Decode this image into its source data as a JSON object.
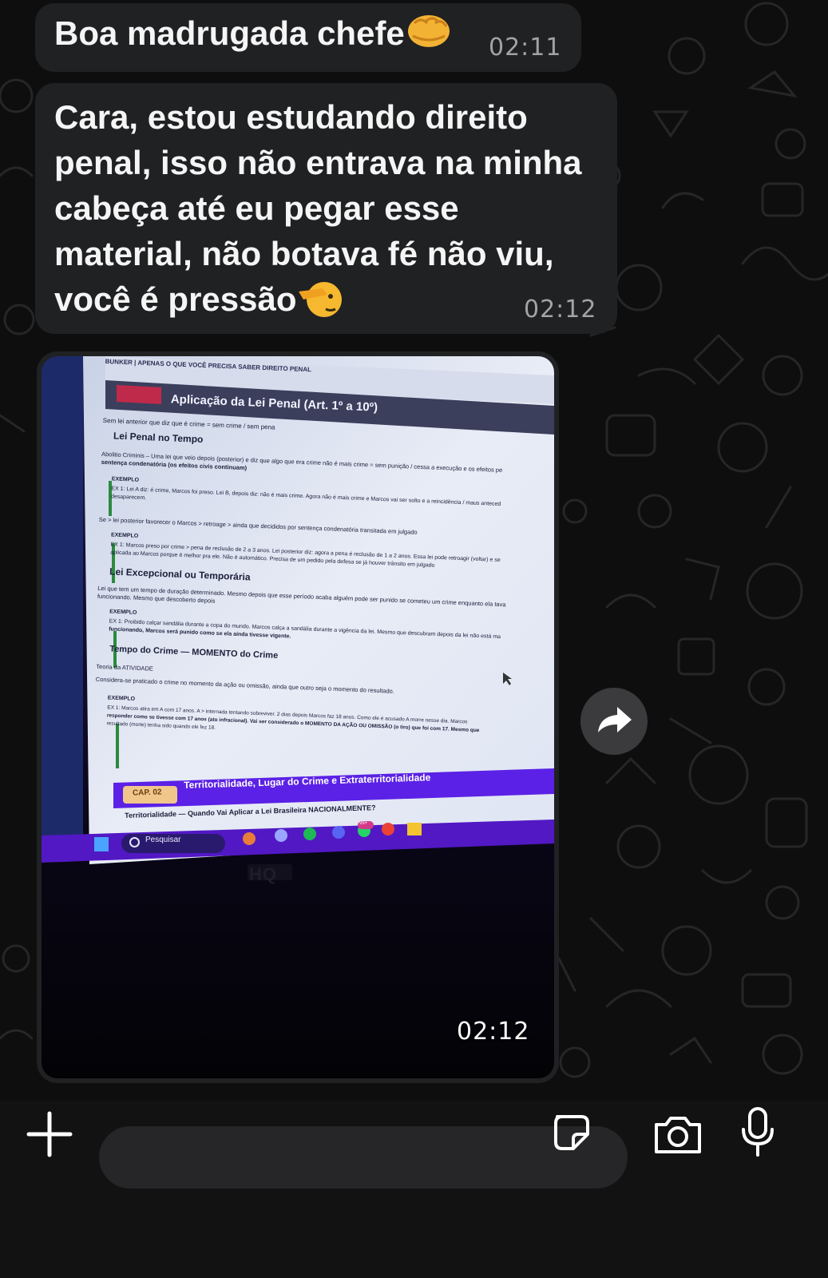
{
  "messages": [
    {
      "id": "m1",
      "text_line1": "Boa madrugada chefe",
      "emoji": "oncoming-fist",
      "time": "02:11"
    },
    {
      "id": "m2",
      "lines": [
        "Cara, estou estudando direito",
        "penal, isso não entrava na minha",
        "cabeça até eu pegar esse",
        "material, não botava fé não viu,",
        "você é pressão"
      ],
      "emoji": "saluting-face",
      "time": "02:12"
    }
  ],
  "photo_message": {
    "time": "02:12",
    "screen": {
      "header": "BUNKER | APENAS O QUE VOCÊ PRECISA SABER   DIREITO PENAL",
      "chapter_title": "Aplicação da Lei Penal (Art. 1º a 10º)",
      "intro": "Sem lei anterior que diz que é crime = sem crime / sem pena",
      "sections": [
        {
          "heading": "Lei Penal no Tempo"
        },
        {
          "heading": "Lei Excepcional ou Temporária"
        },
        {
          "heading": "Tempo do Crime — MOMENTO do Crime"
        }
      ],
      "lines": {
        "abolitio": "Abolitio Criminis – Uma lei que veio depois (posterior) e diz que algo que era crime não é mais crime = sem punição / cessa a execução e os efeitos pe",
        "abolitio2": "sentença condenatória (os efeitos civis continuam)",
        "exemplo": "EXEMPLO",
        "ex1": "EX 1: Lei A diz: é crime, Marcos foi preso. Lei B, depois diz: não é mais crime. Agora não é mais crime e Marcos vai ser solto e a reincidência / maus anteced",
        "ex1b": "desaparecem.",
        "retroage": "Se > lei posterior favorecer o Marcos > retroage > ainda que decididos por sentença condenatória transitada em julgado",
        "ex2": "EX 1: Marcos preso por crime > pena de reclusão de 2 a 3 anos. Lei posterior diz: agora a pena é reclusão de 1 a 2 anos. Essa lei pode retroagir (voltar) e se",
        "ex2b": "aplicada ao Marcos porque é melhor pra ele. Não é automático. Precisa de um pedido pela defesa se já houver trânsito em julgado",
        "excep": "Lei que tem um tempo de duração determinado. Mesmo depois que esse período acaba alguém pode ser punido se cometeu um crime enquanto ela tava",
        "excep2": "funcionando. Mesmo que descoberto depois",
        "ex3": "EX 1: Proibido calçar sandália durante a copa do mundo. Marcos calça a sandália durante a vigência da lei. Mesmo que descubram depois da lei não está ma",
        "ex3b": "funcionando, Marcos será punido como se ela ainda tivesse vigente.",
        "teoria": "Teoria da ATIVIDADE",
        "considera": "Considera-se praticado o crime no momento da ação ou omissão, ainda que outro seja o momento do resultado.",
        "ex4": "EX 1: Marcos atira em A com 17 anos. A > internada tentando sobreviver. 2 dias depois Marcos faz 18 anos. Como ele é acusado A morre nesse dia. Marcos",
        "ex4b": "responder como se tivesse com 17 anos (ato infracional). Vai ser considerado o MOMENTO DA AÇÃO OU OMISSÃO (o tiro) que foi com 17. Mesmo que",
        "ex4c": "resultado (morte) tenha sido quando ele fez 18.",
        "cap_badge": "CAP. 02",
        "cap2_title": "Territorialidade, Lugar do Crime e Extraterritorialidade",
        "cap2_sub": "Territorialidade — Quando Vai Aplicar a Lei Brasileira NACIONALMENTE?"
      },
      "taskbar": {
        "search_placeholder": "Pesquisar",
        "badge": "99+"
      },
      "monitor_brand": "HQ"
    }
  },
  "composer": {
    "plus_icon": "plus-icon",
    "sticker_icon": "sticker-icon",
    "camera_icon": "camera-icon",
    "mic_icon": "microphone-icon",
    "forward_icon": "forward-arrow-icon"
  },
  "colors": {
    "bubble": "#202123",
    "background": "#0e0e0e",
    "time_text": "#a3a3a3",
    "screen_purple": "#5b21e6"
  }
}
